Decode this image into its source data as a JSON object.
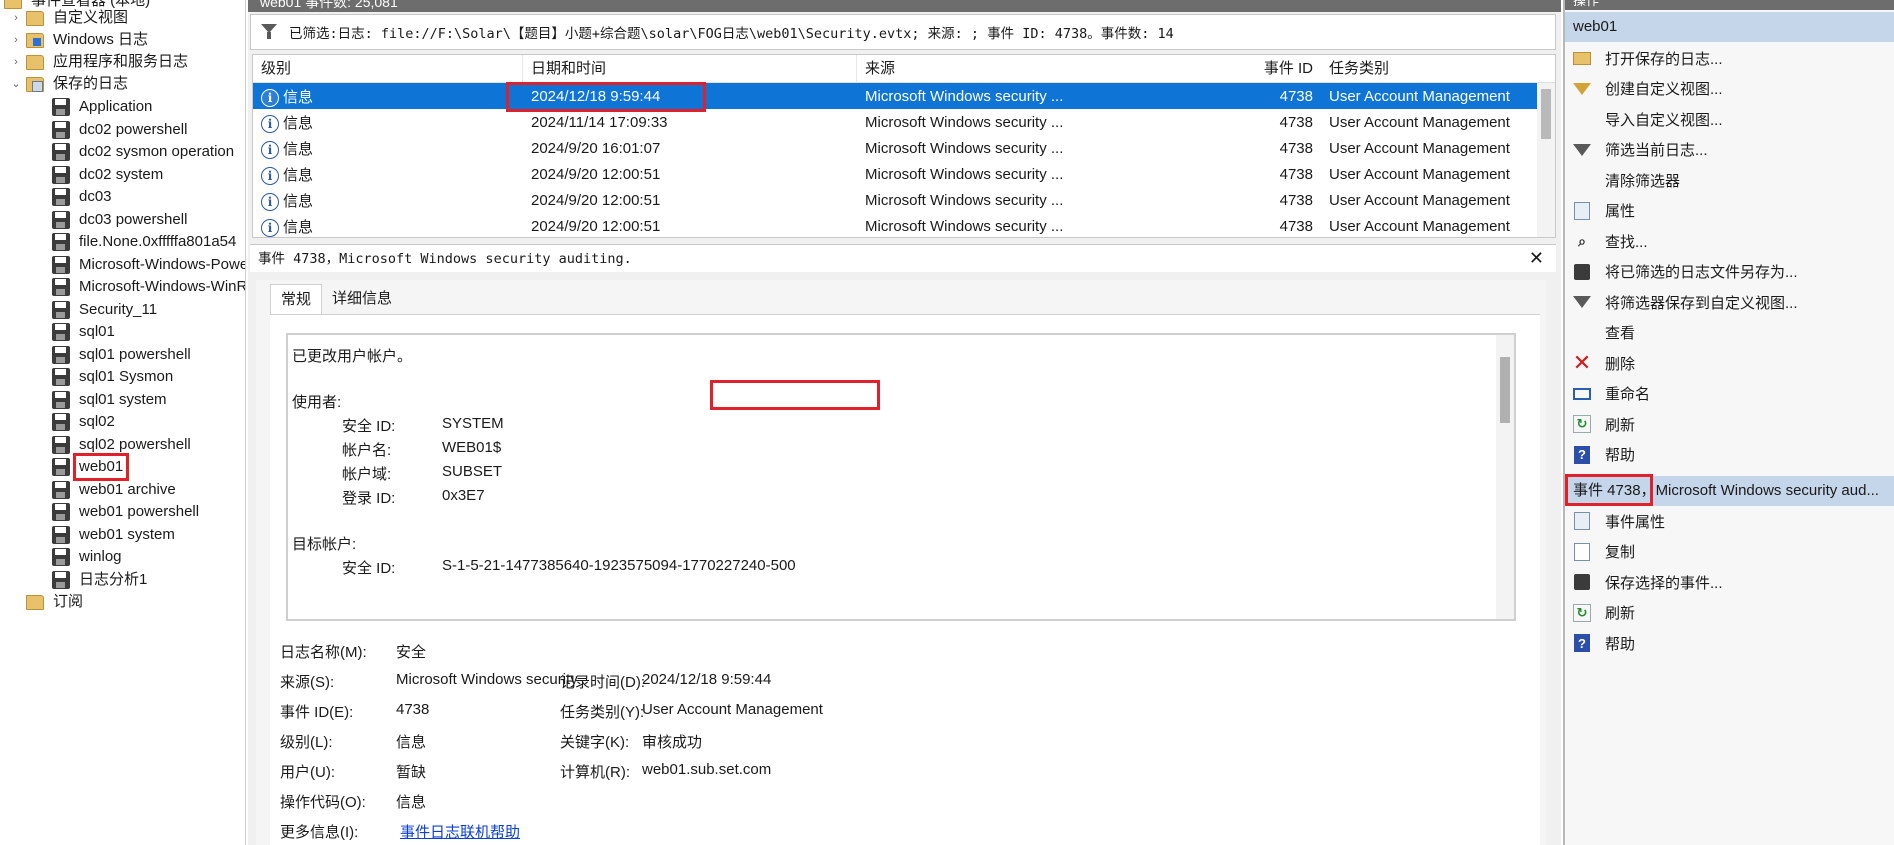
{
  "tree": {
    "top_partial": "事件查看器 (本地)",
    "custom_views": "自定义视图",
    "windows_logs": "Windows 日志",
    "app_logs": "应用程序和服务日志",
    "saved_logs": "保存的日志",
    "saved_items": [
      "Application",
      "dc02 powershell",
      "dc02 sysmon operation",
      "dc02 system",
      "dc03",
      "dc03 powershell",
      "file.None.0xfffffa801a54",
      "Microsoft-Windows-PowerShell",
      "Microsoft-Windows-WinRM",
      "Security_11",
      "sql01",
      "sql01 powershell",
      "sql01 Sysmon",
      "sql01 system",
      "sql02",
      "sql02 powershell",
      "web01",
      "web01  archive",
      "web01 powershell",
      "web01 system",
      "winlog",
      "日志分析1"
    ],
    "subscriptions": "订阅"
  },
  "middle": {
    "title_partial": "web01    事件数: 25,081",
    "filter_text": "已筛选:日志: file://F:\\Solar\\【题目】小题+综合题\\solar\\FOG日志\\web01\\Security.evtx; 来源: ; 事件 ID: 4738。事件数: 14",
    "columns": [
      "级别",
      "日期和时间",
      "来源",
      "事件 ID",
      "任务类别"
    ],
    "rows": [
      {
        "level": "信息",
        "datetime": "2024/12/18 9:59:44",
        "source": "Microsoft Windows security ...",
        "event_id": "4738",
        "task": "User Account Management"
      },
      {
        "level": "信息",
        "datetime": "2024/11/14 17:09:33",
        "source": "Microsoft Windows security ...",
        "event_id": "4738",
        "task": "User Account Management"
      },
      {
        "level": "信息",
        "datetime": "2024/9/20 16:01:07",
        "source": "Microsoft Windows security ...",
        "event_id": "4738",
        "task": "User Account Management"
      },
      {
        "level": "信息",
        "datetime": "2024/9/20 12:00:51",
        "source": "Microsoft Windows security ...",
        "event_id": "4738",
        "task": "User Account Management"
      },
      {
        "level": "信息",
        "datetime": "2024/9/20 12:00:51",
        "source": "Microsoft Windows security ...",
        "event_id": "4738",
        "task": "User Account Management"
      },
      {
        "level": "信息",
        "datetime": "2024/9/20 12:00:51",
        "source": "Microsoft Windows security ...",
        "event_id": "4738",
        "task": "User Account Management"
      }
    ],
    "detail_header": "事件 4738，Microsoft Windows security auditing.",
    "tabs": [
      "常规",
      "详细信息"
    ],
    "message": {
      "line1": "已更改用户帐户。",
      "subject_label": "使用者:",
      "subject": [
        {
          "k": "安全 ID:",
          "v": "SYSTEM"
        },
        {
          "k": "帐户名:",
          "v": "WEB01$"
        },
        {
          "k": "帐户域:",
          "v": "SUBSET"
        },
        {
          "k": "登录 ID:",
          "v": "0x3E7"
        }
      ],
      "target_label": "目标帐户:",
      "target_sid_k": "安全 ID:",
      "target_sid_v": "S-1-5-21-1477385640-1923575094-1770227240-500"
    },
    "props": {
      "log_name_k": "日志名称(M):",
      "log_name_v": "安全",
      "source_k": "来源(S):",
      "source_v": "Microsoft Windows security",
      "logged_k": "记录时间(D):",
      "logged_v": "2024/12/18 9:59:44",
      "eventid_k": "事件 ID(E):",
      "eventid_v": "4738",
      "task_k": "任务类别(Y):",
      "task_v": "User Account Management",
      "level_k": "级别(L):",
      "level_v": "信息",
      "keywords_k": "关键字(K):",
      "keywords_v": "审核成功",
      "user_k": "用户(U):",
      "user_v": "暂缺",
      "computer_k": "计算机(R):",
      "computer_v": "web01.sub.set.com",
      "opcode_k": "操作代码(O):",
      "opcode_v": "信息",
      "more_k": "更多信息(I):",
      "more_v": "事件日志联机帮助"
    }
  },
  "actions": {
    "top_partial": "操作",
    "section1": "web01",
    "items1": [
      {
        "label": "打开保存的日志...",
        "icon": "folder-open-icon"
      },
      {
        "label": "创建自定义视图...",
        "icon": "filter-yellow-icon"
      },
      {
        "label": "导入自定义视图...",
        "icon": ""
      },
      {
        "label": "筛选当前日志...",
        "icon": "filter-icon"
      },
      {
        "label": "清除筛选器",
        "icon": ""
      },
      {
        "label": "属性",
        "icon": "properties-icon"
      },
      {
        "label": "查找...",
        "icon": "binoculars-icon"
      },
      {
        "label": "将已筛选的日志文件另存为...",
        "icon": "save-icon"
      },
      {
        "label": "将筛选器保存到自定义视图...",
        "icon": "filter-icon"
      },
      {
        "label": "查看",
        "icon": ""
      },
      {
        "label": "删除",
        "icon": "delete-icon"
      },
      {
        "label": "重命名",
        "icon": "rename-icon"
      },
      {
        "label": "刷新",
        "icon": "refresh-icon"
      },
      {
        "label": "帮助",
        "icon": "help-icon"
      }
    ],
    "section2_a": "事件 4738",
    "section2_b": "Microsoft Windows security aud...",
    "items2": [
      {
        "label": "事件属性",
        "icon": "properties-icon"
      },
      {
        "label": "复制",
        "icon": "copy-icon"
      },
      {
        "label": "保存选择的事件...",
        "icon": "save-icon"
      },
      {
        "label": "刷新",
        "icon": "refresh-icon"
      },
      {
        "label": "帮助",
        "icon": "help-icon"
      }
    ]
  },
  "colors": {
    "selection": "#0e74d6",
    "highlight_box": "#e0202a",
    "section_bg": "#c5d5ea"
  }
}
